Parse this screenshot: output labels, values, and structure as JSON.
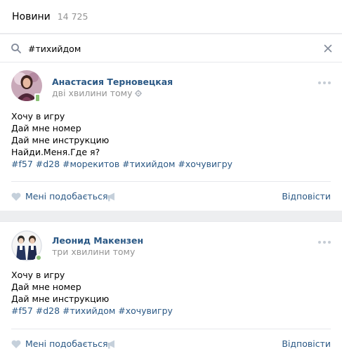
{
  "header": {
    "title": "Новини",
    "count": "14 725"
  },
  "search": {
    "value": "#тихийдом"
  },
  "posts": [
    {
      "author": "Анастасия Терновецкая",
      "time": "дві хвилини тому",
      "lines": [
        "Хочу в игру",
        "Дай мне номер",
        "Дай мне инструкцию",
        "Найди.Меня.Где я?"
      ],
      "tags": "#f57 #d28 #морекитов #тихийдом #хочувигру",
      "like_label": "Мені подобається",
      "reply_label": "Відповісти"
    },
    {
      "author": "Леонид Макензен",
      "time": "три хвилини тому",
      "lines": [
        "Хочу в игру",
        "Дай мне номер",
        "Дай мне инструкцию"
      ],
      "tags": "#f57 #d28 #тихийдом #хочувигру",
      "like_label": "Мені подобається",
      "reply_label": "Відповісти"
    }
  ],
  "colors": {
    "link": "#2a5885",
    "muted": "#939393",
    "background": "#edeef0",
    "online": "#8ac176"
  },
  "icons": [
    "search-icon",
    "clear-icon",
    "gear-icon",
    "more-icon",
    "heart-icon",
    "megaphone-icon"
  ]
}
